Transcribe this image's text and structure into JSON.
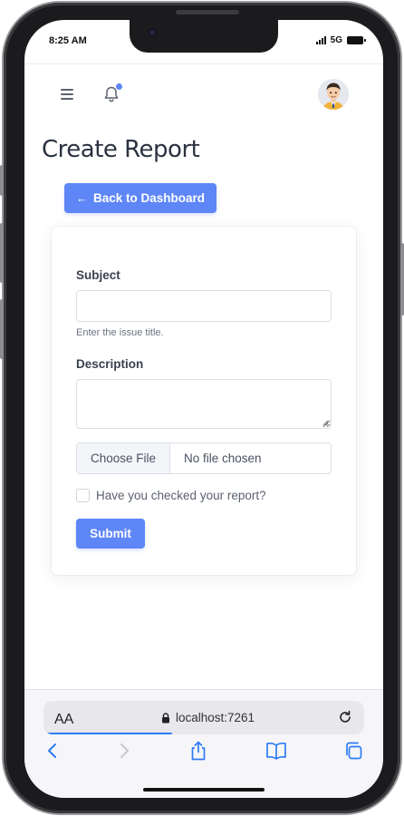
{
  "status_bar": {
    "time": "8:25 AM",
    "network": "5G"
  },
  "header": {
    "menu_icon": "hamburger-menu-icon",
    "bell_icon": "bell-icon",
    "avatar_icon": "user-avatar-icon"
  },
  "page": {
    "title": "Create Report",
    "back_button_label": "Back to Dashboard"
  },
  "form": {
    "subject_label": "Subject",
    "subject_value": "",
    "subject_hint": "Enter the issue title.",
    "description_label": "Description",
    "description_value": "",
    "file_button_label": "Choose File",
    "file_name": "No file chosen",
    "checkbox_label": "Have you checked your report?",
    "checkbox_checked": false,
    "submit_label": "Submit"
  },
  "browser": {
    "text_size_label": "AA",
    "url": "localhost:7261",
    "toolbar_icons": [
      "back-icon",
      "forward-icon",
      "share-icon",
      "bookmarks-icon",
      "tabs-icon"
    ]
  },
  "colors": {
    "accent": "#5e86f6",
    "notification_dot": "#5b84f5",
    "browser_accent": "#2f7bf6"
  }
}
